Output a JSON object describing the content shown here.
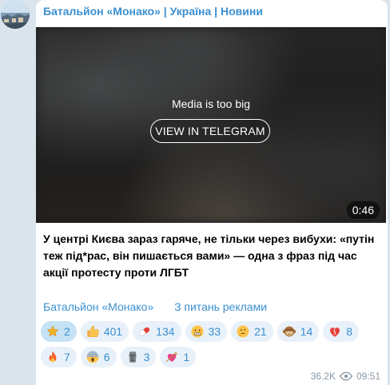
{
  "channel": {
    "title": "Батальйон «Монако» | Україна | Новини"
  },
  "media": {
    "message": "Media is too big",
    "button_label": "VIEW IN TELEGRAM",
    "duration": "0:46"
  },
  "post": {
    "text": "У центрі Києва зараз гаряче, не тільки через вибухи: «путін теж під*рас, він пишається вами» — одна з фраз під час акції протесту проти ЛГБТ"
  },
  "links": {
    "channel_link": "Батальйон «Монако»",
    "ads_link": "З питань реклами"
  },
  "reactions_row1": [
    {
      "icon": "star-icon",
      "count": "2"
    },
    {
      "icon": "thumbs-up-icon",
      "count": "401"
    },
    {
      "icon": "pill-icon",
      "count": "134"
    },
    {
      "icon": "grimace-face-icon",
      "count": "33"
    },
    {
      "icon": "thinking-face-icon",
      "count": "21"
    },
    {
      "icon": "see-no-evil-monkey-icon",
      "count": "14"
    },
    {
      "icon": "broken-heart-icon",
      "count": "8"
    }
  ],
  "reactions_row2": [
    {
      "icon": "fire-icon",
      "count": "7"
    },
    {
      "icon": "screaming-face-icon",
      "count": "6"
    },
    {
      "icon": "moai-icon",
      "count": "3"
    },
    {
      "icon": "heart-with-arrow-icon",
      "count": "1"
    }
  ],
  "footer": {
    "views": "36.2K",
    "time": "09:51"
  },
  "colors": {
    "link": "#3a8fd0",
    "reaction_bg": "#e8f1f9",
    "page_bg": "#d9e4ec"
  }
}
